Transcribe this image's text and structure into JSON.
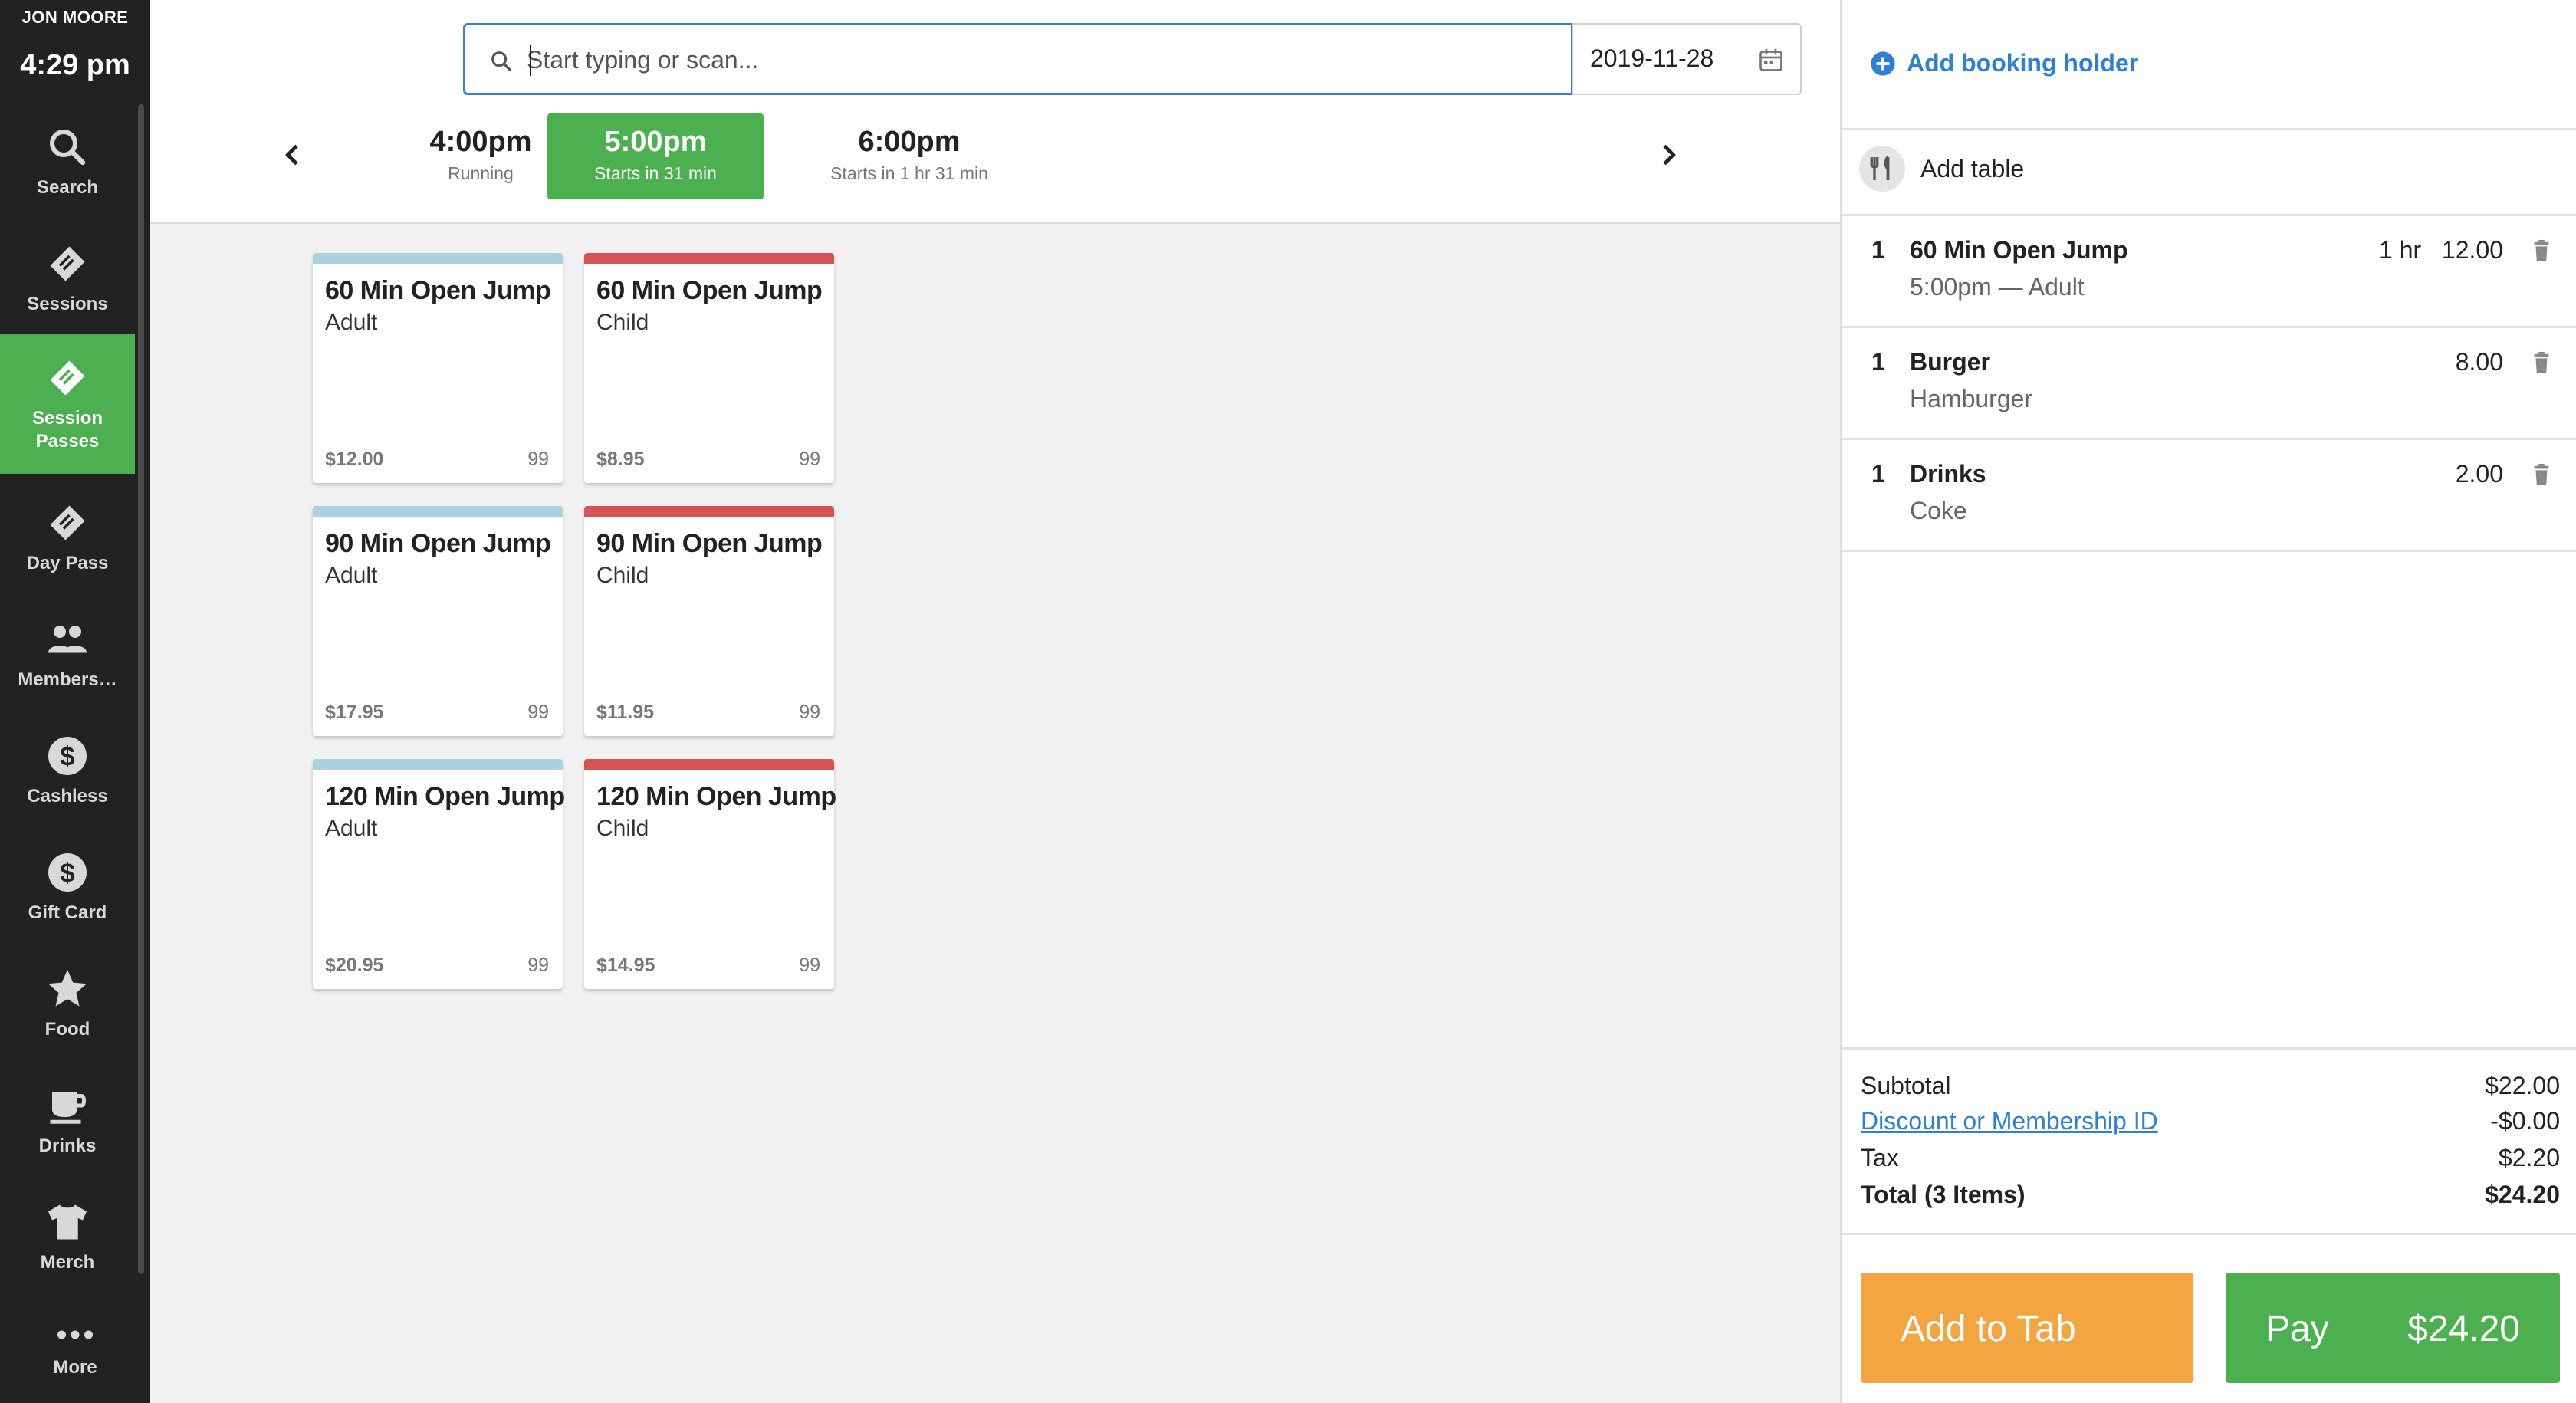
{
  "sidebar": {
    "user": "JON MOORE",
    "time": "4:29 pm",
    "items": [
      {
        "label": "Search",
        "icon": "search-icon"
      },
      {
        "label": "Sessions",
        "icon": "ticket-icon"
      },
      {
        "label": "Session Passes",
        "icon": "ticket-icon",
        "active": true
      },
      {
        "label": "Day Pass",
        "icon": "ticket-icon"
      },
      {
        "label": "Members…",
        "icon": "people-icon"
      },
      {
        "label": "Cashless",
        "icon": "dollar-icon"
      },
      {
        "label": "Gift Card",
        "icon": "dollar-icon"
      },
      {
        "label": "Food",
        "icon": "star-icon"
      },
      {
        "label": "Drinks",
        "icon": "cup-icon"
      },
      {
        "label": "Merch",
        "icon": "shirt-icon"
      },
      {
        "label": "More",
        "icon": "more-icon"
      }
    ]
  },
  "search": {
    "placeholder": "Start typing or scan...",
    "value": ""
  },
  "date": {
    "value": "2019-11-28"
  },
  "time_slots": [
    {
      "time": "4:00pm",
      "status": "Running"
    },
    {
      "time": "5:00pm",
      "status": "Starts in 31 min",
      "active": true
    },
    {
      "time": "6:00pm",
      "status": "Starts in 1 hr 31 min"
    }
  ],
  "products": [
    {
      "title": "60 Min Open Jump",
      "subtitle": "Adult",
      "price": "$12.00",
      "qty": "99",
      "type": "adult"
    },
    {
      "title": "60 Min Open Jump",
      "subtitle": "Child",
      "price": "$8.95",
      "qty": "99",
      "type": "child"
    },
    {
      "title": "90 Min Open Jump",
      "subtitle": "Adult",
      "price": "$17.95",
      "qty": "99",
      "type": "adult"
    },
    {
      "title": "90 Min Open Jump",
      "subtitle": "Child",
      "price": "$11.95",
      "qty": "99",
      "type": "child"
    },
    {
      "title": "120 Min Open Jump",
      "subtitle": "Adult",
      "price": "$20.95",
      "qty": "99",
      "type": "adult"
    },
    {
      "title": "120 Min Open Jump",
      "subtitle": "Child",
      "price": "$14.95",
      "qty": "99",
      "type": "child"
    }
  ],
  "cart": {
    "add_holder_label": "Add booking holder",
    "add_table_label": "Add table",
    "lines": [
      {
        "qty": "1",
        "name": "60 Min Open Jump",
        "sub": "5:00pm — Adult",
        "duration": "1 hr",
        "price": "12.00"
      },
      {
        "qty": "1",
        "name": "Burger",
        "sub": "Hamburger",
        "duration": "",
        "price": "8.00"
      },
      {
        "qty": "1",
        "name": "Drinks",
        "sub": "Coke",
        "duration": "",
        "price": "2.00"
      }
    ],
    "subtotal_label": "Subtotal",
    "subtotal": "$22.00",
    "discount_label": "Discount or Membership ID",
    "discount": "-$0.00",
    "tax_label": "Tax",
    "tax": "$2.20",
    "total_label": "Total (3 Items)",
    "total": "$24.20",
    "add_to_tab_label": "Add to Tab",
    "pay_label": "Pay",
    "pay_amount": "$24.20"
  },
  "colors": {
    "accent_green": "#4caf50",
    "link_blue": "#2f80d1",
    "tab_orange": "#f2a541",
    "adult_stripe": "#a8d3de",
    "child_stripe": "#d75454",
    "sidebar_bg": "#222222"
  }
}
